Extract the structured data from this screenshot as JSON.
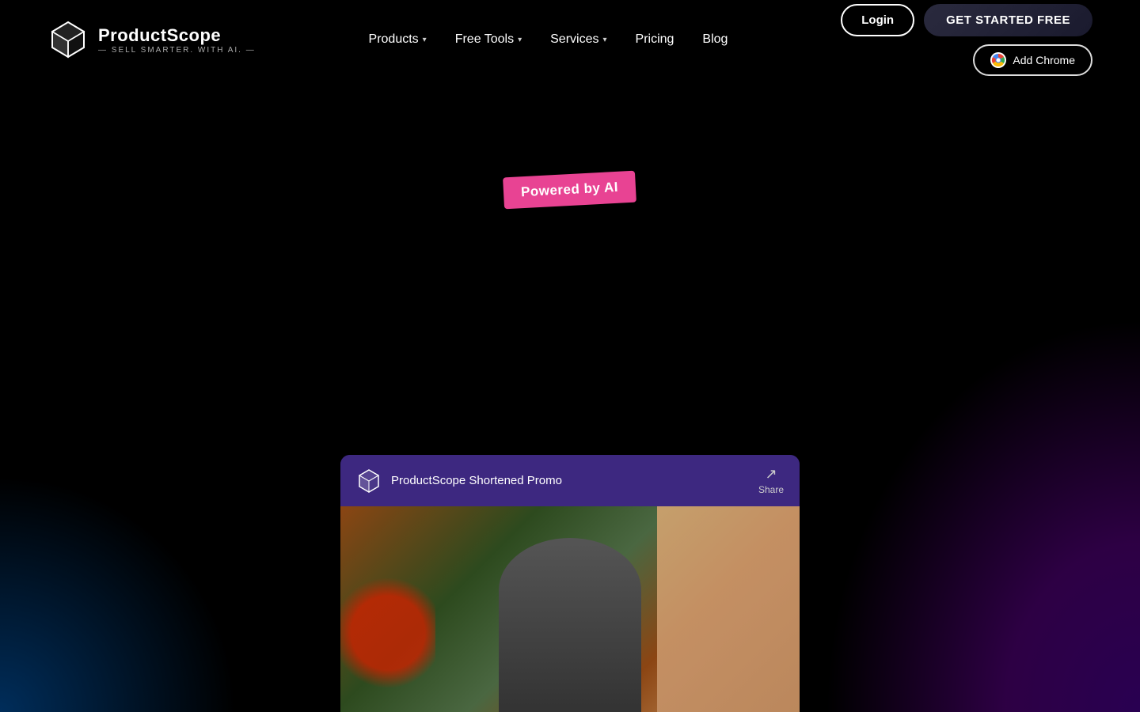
{
  "logo": {
    "main_text": "ProductScope",
    "sub_text": "— SELL SMARTER. WITH AI. —",
    "icon_label": "productscope-logo"
  },
  "nav": {
    "items": [
      {
        "label": "Products",
        "has_dropdown": true
      },
      {
        "label": "Free Tools",
        "has_dropdown": true
      },
      {
        "label": "Services",
        "has_dropdown": true
      },
      {
        "label": "Pricing",
        "has_dropdown": false
      },
      {
        "label": "Blog",
        "has_dropdown": false
      }
    ]
  },
  "actions": {
    "login_label": "Login",
    "get_started_label": "GET STARTED FREE",
    "add_chrome_label": "Add Chrome"
  },
  "hero": {
    "badge_text": "Powered by AI"
  },
  "video": {
    "title": "ProductScope Shortened Promo",
    "share_label": "Share"
  },
  "colors": {
    "badge_bg": "#e84393",
    "nav_bg": "#000000",
    "video_header_bg": "#3d2880"
  }
}
